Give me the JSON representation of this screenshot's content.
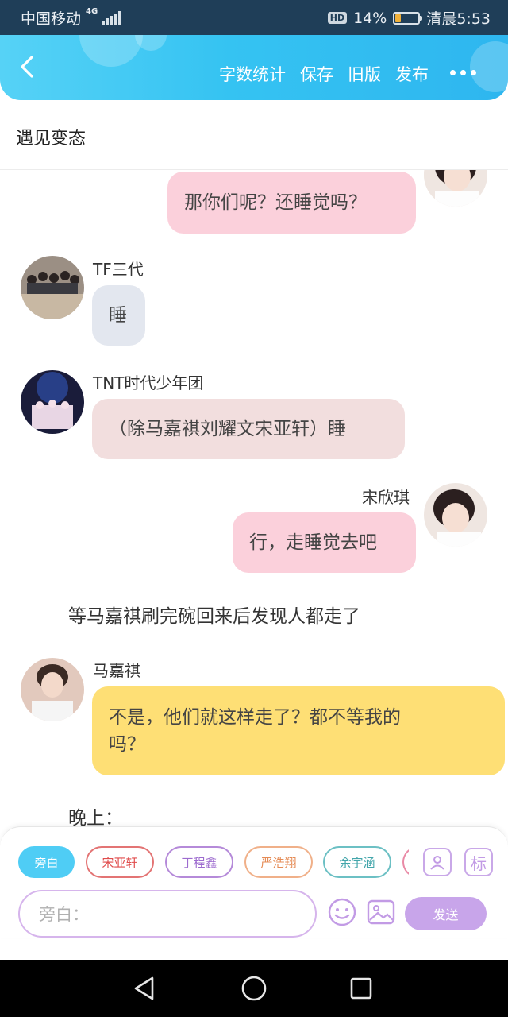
{
  "status_bar": {
    "carrier": "中国移动",
    "network": "4G",
    "hd": "HD",
    "battery_pct": "14%",
    "time": "清晨5:53",
    "battery_level": 0.14
  },
  "header": {
    "actions": [
      "字数统计",
      "保存",
      "旧版",
      "发布"
    ]
  },
  "title": "遇见变态",
  "chat": {
    "m1": {
      "text": "那你们呢？还睡觉吗？"
    },
    "m2": {
      "name": "TF三代",
      "text": "睡"
    },
    "m3": {
      "name": "TNT时代少年团",
      "text": "（除马嘉祺刘耀文宋亚轩）睡"
    },
    "m4": {
      "name": "宋欣琪",
      "text": "行，走睡觉去吧"
    },
    "n1": {
      "text": "等马嘉祺刷完碗回来后发现人都走了"
    },
    "m5": {
      "name": "马嘉祺",
      "line1": "不是，他们就这样走了？都不等我的",
      "line2": "吗？"
    },
    "n2": {
      "text": "晚上："
    }
  },
  "input_panel": {
    "chips": [
      "旁白",
      "宋亚轩",
      "丁程鑫",
      "严浩翔",
      "余宇涵"
    ],
    "tool_label": "标",
    "placeholder": "旁白：",
    "send_label": "发送"
  },
  "colors": {
    "header_blue": "#35c3f2",
    "pink_bubble": "#fbd0db",
    "yellow_bubble": "#fedf75",
    "send_purple": "#c8a5ea"
  }
}
